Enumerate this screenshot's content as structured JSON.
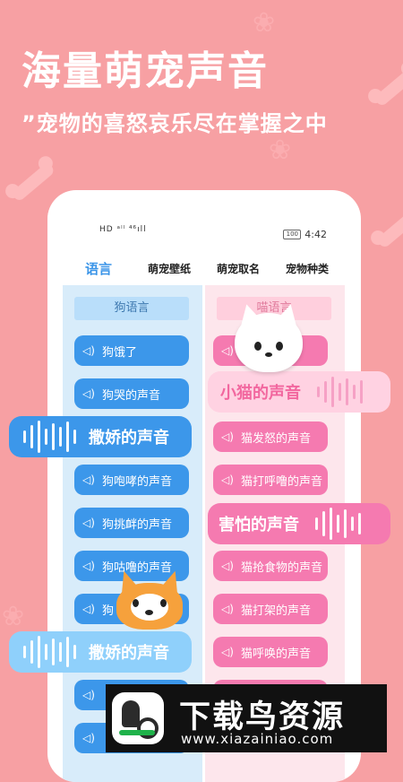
{
  "promo": {
    "headline": "海量萌宠声音",
    "subline": "”宠物的喜怒哀乐尽在掌握之中"
  },
  "status_bar": {
    "signal_text": "HD ᵃˡˡ ⁴⁶ıll",
    "battery": "100",
    "time": "4:42"
  },
  "tabs": [
    {
      "label": "语言",
      "active": true
    },
    {
      "label": "萌宠壁纸",
      "active": false
    },
    {
      "label": "萌宠取名",
      "active": false
    },
    {
      "label": "宠物种类",
      "active": false
    }
  ],
  "dog_column": {
    "header": "狗语言",
    "items": [
      "狗饿了",
      "狗哭的声音",
      "狗咆哮的声音",
      "狗挑衅的声音",
      "狗咕噜的声音",
      "狗"
    ]
  },
  "cat_column": {
    "header": "喵语言",
    "items": [
      "猫发怒的声音",
      "猫打呼噜的声音",
      "猫抢食物的声音",
      "猫打架的声音",
      "猫呼唤的声音"
    ]
  },
  "callouts": {
    "kitten": "小猫的声音",
    "coy_blue": "撒娇的声音",
    "scared": "害怕的声音",
    "coy_light": "撒娇的声音"
  },
  "watermark": {
    "brand": "下载鸟资源",
    "domain": "www.xiazainiao.com"
  },
  "colors": {
    "background": "#f7a0a3",
    "blue_button": "#3c97ea",
    "pink_button": "#f57ab0",
    "active_tab": "#3b95e8"
  }
}
